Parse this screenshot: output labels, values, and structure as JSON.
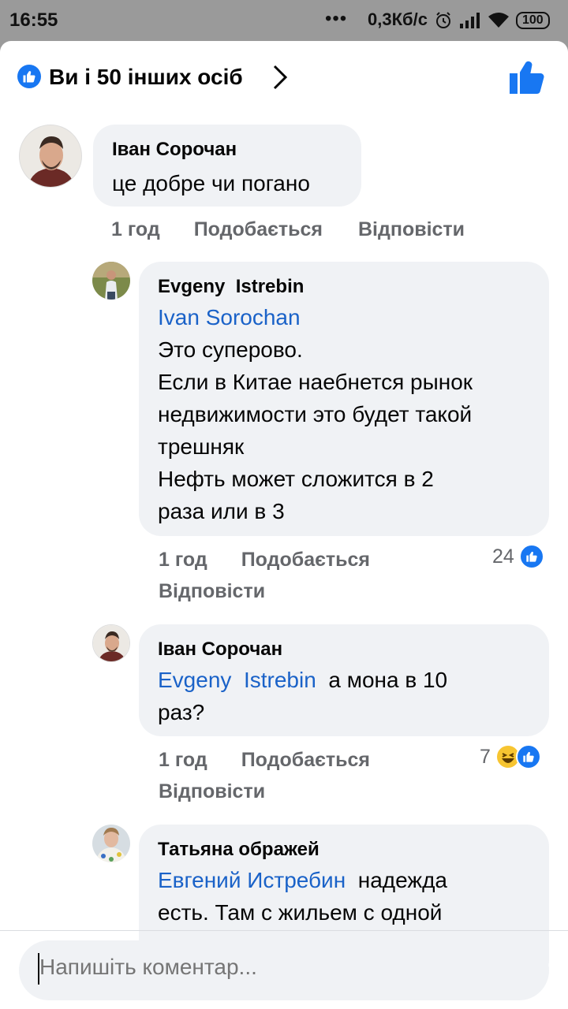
{
  "status_bar": {
    "time": "16:55",
    "dots": "•••",
    "speed": "0,3Кб/с",
    "battery": "100"
  },
  "header": {
    "title": "Ви і 50 інших осіб"
  },
  "comments": [
    {
      "author": "Іван Сорочан",
      "text": "це добре чи погано",
      "time": "1 год",
      "like_label": "Подобається",
      "reply_label": "Відповісти"
    },
    {
      "author": "Evgeny  Istrebin",
      "mention": "Ivan Sorochan",
      "text_lines": [
        "Это суперово.",
        "Если в Китае наебнется рынок",
        "недвижимости это будет такой",
        "трешняк",
        "Нефть может сложится в 2",
        "раза или в 3"
      ],
      "time": "1 год",
      "like_label": "Подобається",
      "reply_label": "Відповісти",
      "reaction_count": "24"
    },
    {
      "author": "Іван Сорочан",
      "mention": "Evgeny  Istrebin",
      "text_first": "а мона в 10",
      "text_second": "раз?",
      "time": "1 год",
      "like_label": "Подобається",
      "reply_label": "Відповісти",
      "reaction_count": "7"
    },
    {
      "author": "Татьяна ображей",
      "mention": "Евгений Истребин",
      "text_first": "надежда",
      "text_second": "есть. Там с жильем с одной"
    }
  ],
  "composer": {
    "placeholder": "Напишіть коментар..."
  },
  "colors": {
    "accent": "#1877f2",
    "mention": "#1a62c8",
    "bubble": "#f0f2f5",
    "meta": "#65676b"
  },
  "icons": [
    "like-badge-icon",
    "chevron-right-icon",
    "thumbs-up-icon",
    "haha-icon",
    "signal-icon",
    "wifi-icon",
    "alarm-icon"
  ]
}
